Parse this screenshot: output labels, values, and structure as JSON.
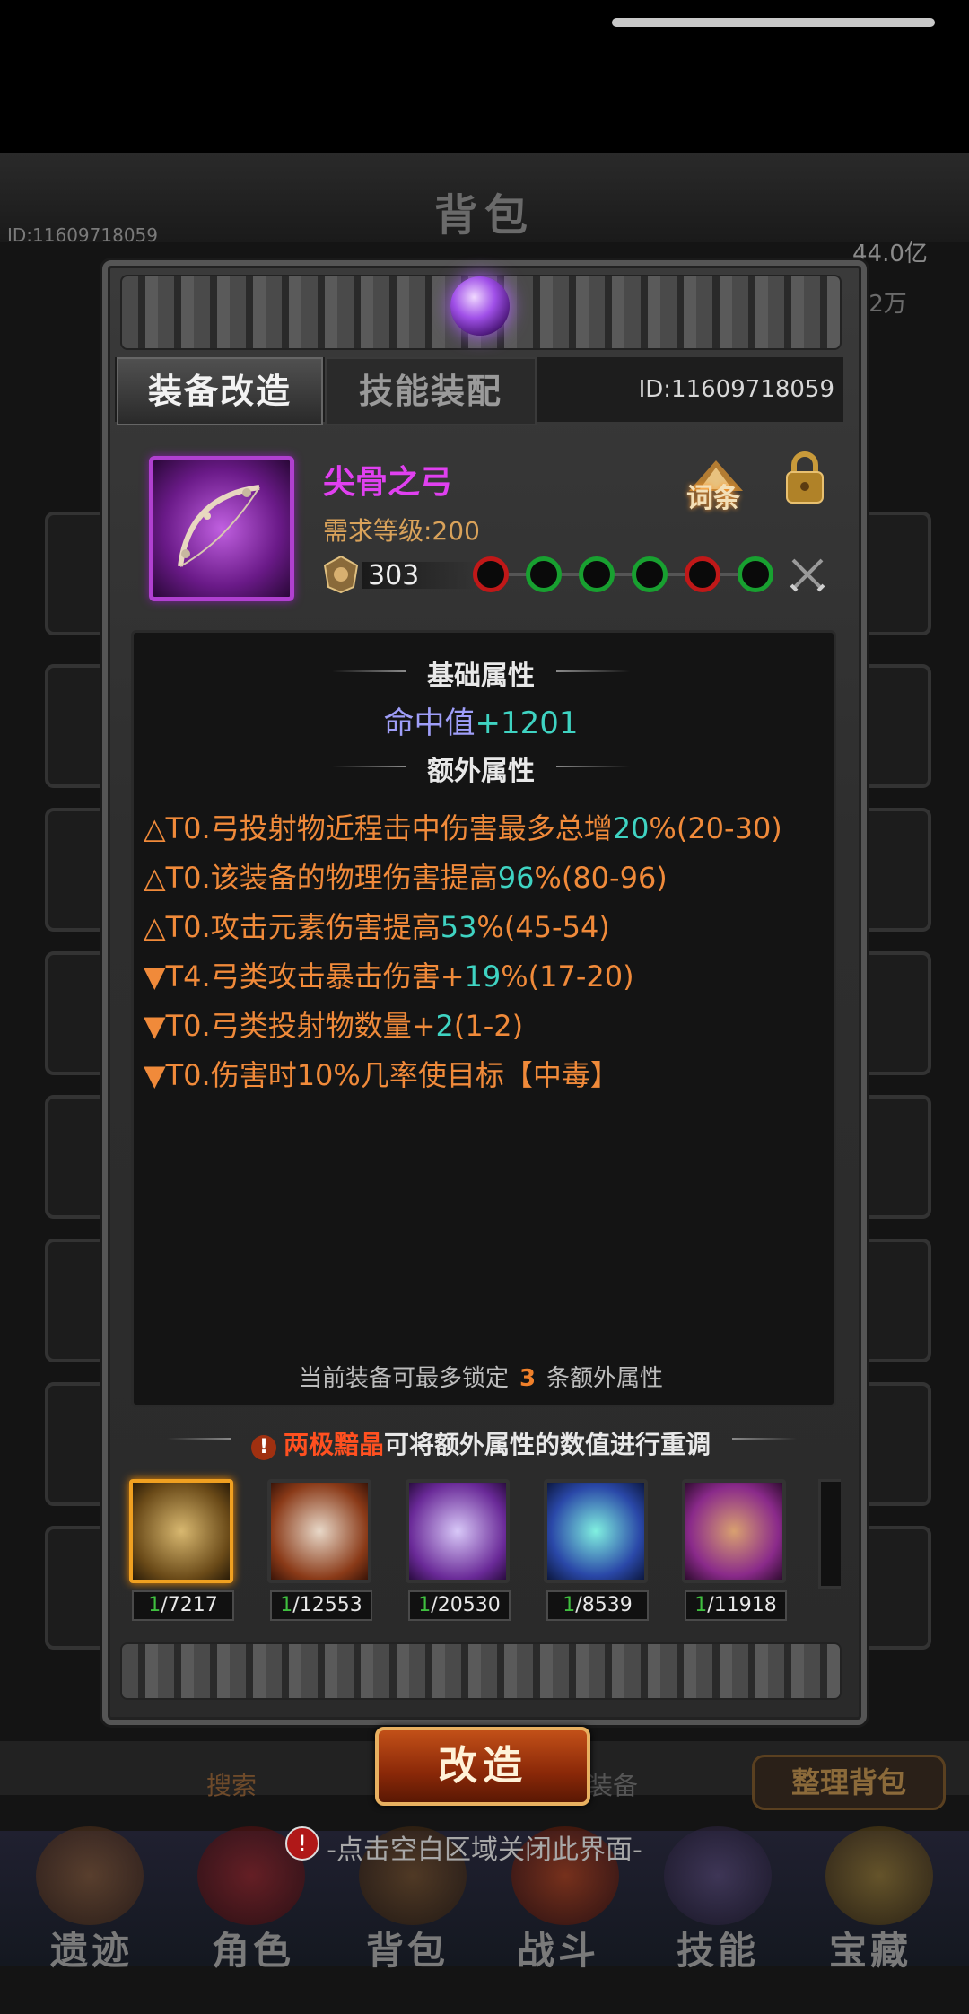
{
  "background": {
    "title": "背包",
    "player_id": "ID:11609718059",
    "gold": "44.0亿",
    "diamond": ".2万",
    "search_label": "搜索",
    "equip_label": "装备",
    "sort_label": "整理背包",
    "nav": [
      "遗迹",
      "角色",
      "背包",
      "战斗",
      "技能",
      "宝藏"
    ],
    "nav_badge": "!"
  },
  "modal": {
    "tabs": [
      "装备改造",
      "技能装配"
    ],
    "id_label": "ID:11609718059",
    "item": {
      "name": "尖骨之弓",
      "level_req": "需求等级:200",
      "power": "303",
      "affix_button": "词条",
      "sockets": [
        "red",
        "green",
        "green",
        "green",
        "red",
        "green"
      ]
    },
    "base_title": "基础属性",
    "base_attr_label": "命中值",
    "base_attr_value": "+1201",
    "extra_title": "额外属性",
    "extra_attrs": [
      {
        "pre": "△T0.弓投射物近程击中伤害最多总增",
        "num": "20",
        "post": "%(20-30)"
      },
      {
        "pre": "△T0.该装备的物理伤害提高",
        "num": "96",
        "post": "%(80-96)"
      },
      {
        "pre": "△T0.攻击元素伤害提高",
        "num": "53",
        "post": "%(45-54)"
      },
      {
        "pre": "▼T4.弓类攻击暴击伤害+",
        "num": "19",
        "post": "%(17-20)"
      },
      {
        "pre": "▼T0.弓类投射物数量+",
        "num": "2",
        "post": "(1-2)"
      },
      {
        "pre": "▼T0.伤害时10%几率使目标【中毒】",
        "num": "",
        "post": ""
      }
    ],
    "lock_note_pre": "当前装备可最多锁定",
    "lock_note_num": "3",
    "lock_note_post": "条额外属性",
    "material_hint_highlight": "两极黯晶",
    "material_hint_rest": "可将额外属性的数值进行重调",
    "materials": [
      {
        "have": "1",
        "total": "/7217",
        "color": "#b08a40",
        "icon": "yin-yang-orb-icon"
      },
      {
        "have": "1",
        "total": "/12553",
        "color": "#a04a28",
        "icon": "twin-masks-icon"
      },
      {
        "have": "1",
        "total": "/20530",
        "color": "#7a3aa0",
        "icon": "crystal-ore-icon"
      },
      {
        "have": "1",
        "total": "/8539",
        "color": "#2a48a8",
        "icon": "prism-stone-icon"
      },
      {
        "have": "1",
        "total": "/11918",
        "color": "#8a2a8a",
        "icon": "crimson-ore-icon"
      }
    ],
    "modify_button": "改造",
    "close_hint": "-点击空白区域关闭此界面-"
  },
  "colors": {
    "accent_orange": "#f08a3a",
    "value_cyan": "#3fd3c2",
    "epic_purple": "#e040f0",
    "socket_red": "#c01818",
    "socket_green": "#18a030"
  }
}
